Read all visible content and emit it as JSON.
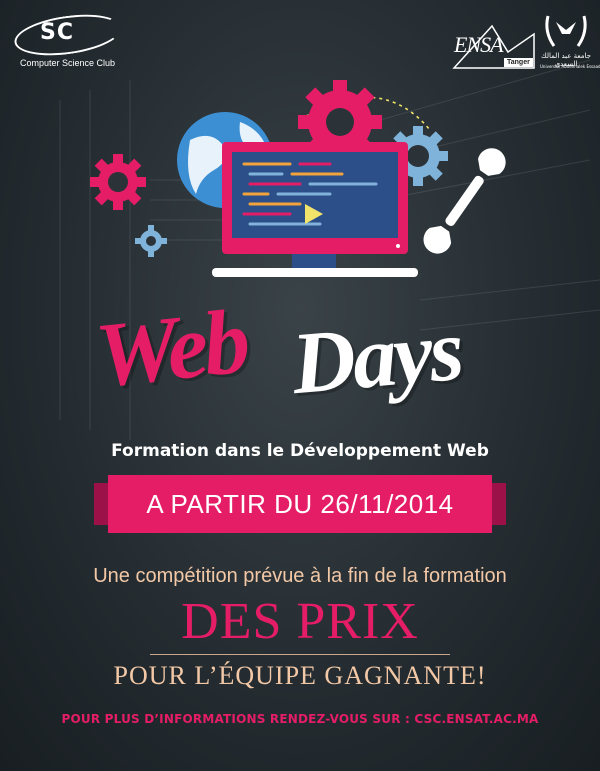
{
  "logos": {
    "csc": {
      "mark": "SC",
      "name": "Computer Science Club"
    },
    "ensa": {
      "mark": "ENSA",
      "city": "Tanger"
    },
    "university": {
      "arabic": "جامعة عبد المالك السعدي",
      "latin": "Université Abdelmalek Essaadi"
    }
  },
  "illustration": {
    "icons": [
      "globe-icon",
      "monitor-icon",
      "gear-icon",
      "wrench-icon",
      "play-icon"
    ],
    "colors": {
      "pink": "#e51d66",
      "globe": "#3d8fd4",
      "light_blue": "#7fb3da",
      "screen": "#2c4f8a",
      "white": "#ffffff"
    }
  },
  "title": {
    "part1": "Web",
    "part2": "Days"
  },
  "subtitle": "Formation dans le Développement Web",
  "date_banner": "A PARTIR DU 26/11/2014",
  "competition": "Une compétition prévue à la fin de la formation",
  "prix": "DES PRIX",
  "gagnante": "POUR L’ÉQUIPE GAGNANTE!",
  "info": "POUR PLUS D’INFORMATIONS RENDEZ-VOUS SUR : CSC.ENSAT.AC.MA",
  "colors": {
    "accent": "#e51d66",
    "peach": "#f3c8a6",
    "background": "#252d32"
  }
}
